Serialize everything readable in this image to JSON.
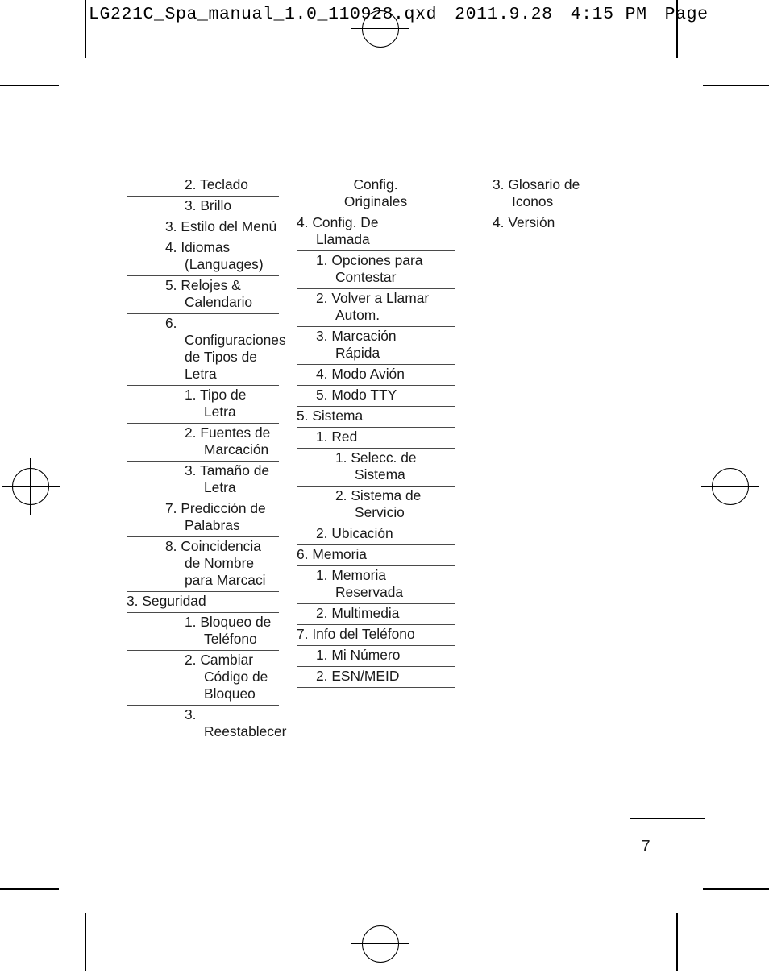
{
  "header": {
    "filename": "LG221C_Spa_manual_1.0_110928.qxd",
    "date": "2011.9.28",
    "time": "4:15",
    "meridiem": "PM",
    "page_label": "Page"
  },
  "footer": {
    "page_number": "7"
  },
  "columns": [
    {
      "name": "column-1",
      "rows": [
        {
          "level": 3,
          "text": "2. Teclado"
        },
        {
          "level": 3,
          "text": "3. Brillo"
        },
        {
          "level": 2,
          "text": "3. Estilo del Menú"
        },
        {
          "level": 2,
          "text": "4. Idiomas\n(Languages)"
        },
        {
          "level": 2,
          "text": "5. Relojes &\nCalendario"
        },
        {
          "level": 2,
          "text": "6. Configuraciones\nde Tipos de\nLetra"
        },
        {
          "level": 3,
          "text": "1. Tipo de\nLetra"
        },
        {
          "level": 3,
          "text": "2. Fuentes de\nMarcación"
        },
        {
          "level": 3,
          "text": "3. Tamaño de\nLetra"
        },
        {
          "level": 2,
          "text": "7. Predicción de\nPalabras"
        },
        {
          "level": 2,
          "text": "8. Coincidencia\nde Nombre\npara Marcaci"
        },
        {
          "level": 0,
          "text": "3. Seguridad"
        },
        {
          "level": 3,
          "text": "1. Bloqueo de\nTeléfono"
        },
        {
          "level": 3,
          "text": "2. Cambiar\nCódigo de\nBloqueo"
        },
        {
          "level": 3,
          "text": "3. Reestablecer"
        }
      ]
    },
    {
      "name": "column-2",
      "rows": [
        {
          "level": 0,
          "fragment": true,
          "text": "Config.\nOriginales"
        },
        {
          "level": 0,
          "text": "4. Config. De\nLlamada"
        },
        {
          "level": 1,
          "text": "1. Opciones para\nContestar"
        },
        {
          "level": 1,
          "text": "2. Volver a Llamar\nAutom."
        },
        {
          "level": 1,
          "text": "3. Marcación\nRápida"
        },
        {
          "level": 1,
          "text": "4. Modo Avión"
        },
        {
          "level": 1,
          "text": "5. Modo TTY"
        },
        {
          "level": 0,
          "text": "5. Sistema"
        },
        {
          "level": 1,
          "text": "1. Red"
        },
        {
          "level": 2,
          "text": "1. Selecc. de\nSistema"
        },
        {
          "level": 2,
          "text": "2. Sistema de\nServicio"
        },
        {
          "level": 1,
          "text": "2. Ubicación"
        },
        {
          "level": 0,
          "text": "6. Memoria"
        },
        {
          "level": 1,
          "text": "1. Memoria\nReservada"
        },
        {
          "level": 1,
          "text": "2. Multimedia"
        },
        {
          "level": 0,
          "text": "7. Info del Teléfono"
        },
        {
          "level": 1,
          "text": "1. Mi Número"
        },
        {
          "level": 1,
          "text": "2. ESN/MEID"
        }
      ]
    },
    {
      "name": "column-3",
      "rows": [
        {
          "level": 1,
          "text": "3. Glosario de\nIconos"
        },
        {
          "level": 1,
          "text": "4. Versión"
        }
      ]
    }
  ]
}
